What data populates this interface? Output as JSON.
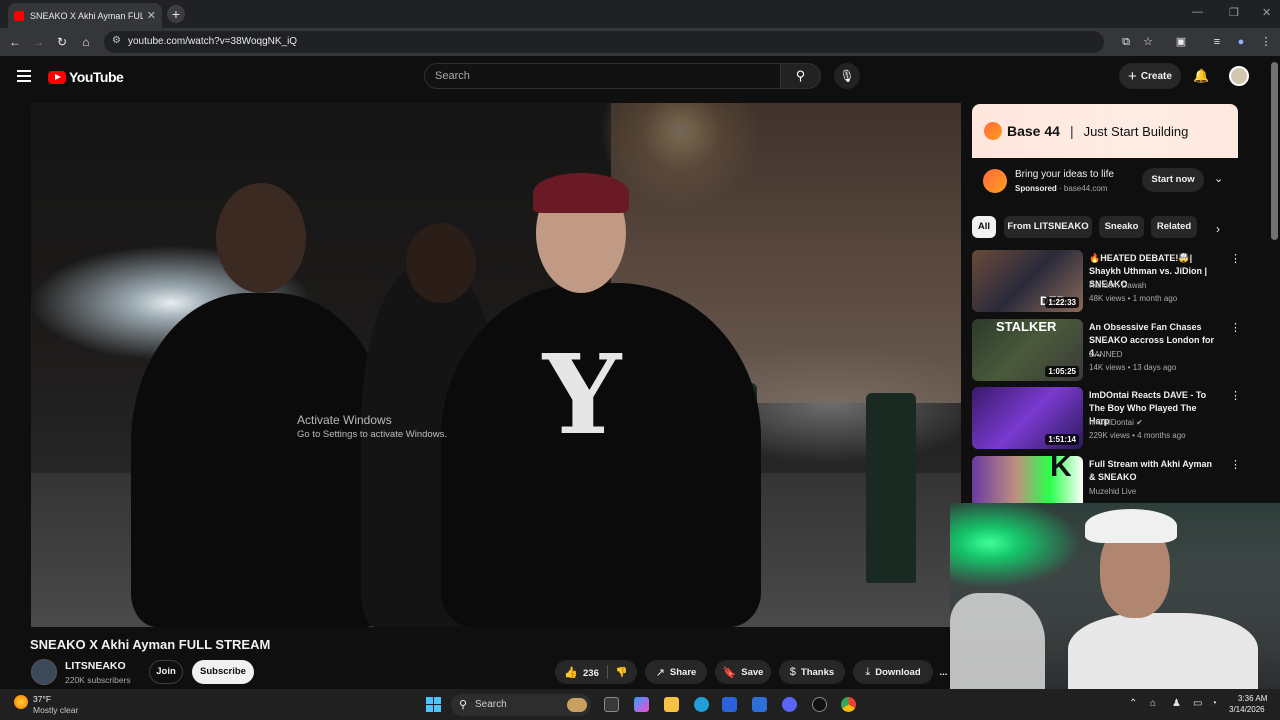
{
  "browser": {
    "tab_title": "SNEAKO X Akhi Ayman FULL STREAM - YouTube",
    "tab_title_visible": "SNEAKO X Akhi Ayman FULL S",
    "new_tab": "+",
    "url": "youtube.com/watch?v=38WoqgNK_iQ"
  },
  "header": {
    "logo_text": "YouTube",
    "search_placeholder": "Search",
    "create_label": "Create"
  },
  "video": {
    "watermark_line1": "Activate Windows",
    "watermark_line2": "Go to Settings to activate Windows.",
    "title": "SNEAKO X Akhi Ayman FULL STREAM",
    "channel_name": "LITSNEAKO",
    "subscribers": "220K subscribers",
    "join_label": "Join",
    "subscribe_label": "Subscribe",
    "likes": "236",
    "share_label": "Share",
    "save_label": "Save",
    "thanks_label": "Thanks",
    "download_label": "Download",
    "more_label": "..."
  },
  "ad": {
    "brand": "Base 44",
    "divider": "|",
    "tagline": "Just Start Building",
    "headline": "Bring your ideas to life",
    "sponsored": "Sponsored",
    "domain": "base44.com",
    "cta": "Start now"
  },
  "chips": [
    "All",
    "From LITSNEAKO",
    "Sneako",
    "Related"
  ],
  "recommendations": [
    {
      "title": "🔥HEATED DEBATE!🤯| Shaykh Uthman vs. JiDion | SNEAKO",
      "channel": "Random Dawah",
      "meta": "48K views • 1 month ago",
      "duration": "1:22:33",
      "overlay": "DEB"
    },
    {
      "title": "An Obsessive Fan Chases SNEAKO accross London for 4...",
      "channel": "BANNED",
      "meta": "14K views • 13 days ago",
      "duration": "1:05:25",
      "overlay": "STALKER"
    },
    {
      "title": "ImDOntai Reacts DAVE - To The Boy Who Played The Harp",
      "channel": "ImStillDontai",
      "meta": "229K views • 4 months ago",
      "duration": "1:51:14",
      "overlay": ""
    },
    {
      "title": "Full Stream with Akhi Ayman & SNEAKO",
      "channel": "Muzehid Live",
      "meta": "",
      "duration": "",
      "overlay": "K"
    }
  ],
  "taskbar": {
    "temp": "37°F",
    "weather": "Mostly clear",
    "search": "Search",
    "time": "3:36 AM",
    "date": "3/14/2026"
  },
  "colors": {
    "yt_red": "#ff0000",
    "bg": "#0f0f0f",
    "pill": "#272727",
    "win_blue": "#4cc2ff"
  }
}
